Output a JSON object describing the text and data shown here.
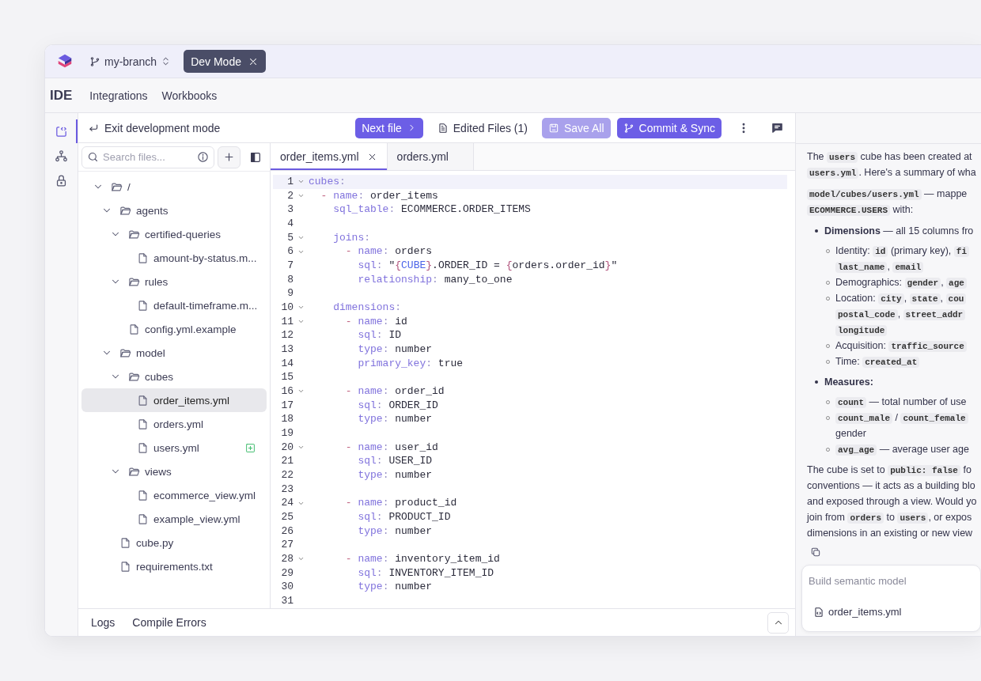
{
  "top_bar": {
    "branch": "my-branch",
    "mode_chip": "Dev Mode"
  },
  "nav": {
    "title": "IDE",
    "items": [
      {
        "label": "Integrations"
      },
      {
        "label": "Workbooks"
      }
    ]
  },
  "rail": [
    {
      "kind": "code",
      "selected": true
    },
    {
      "kind": "hierarchy",
      "selected": false
    },
    {
      "kind": "lock",
      "selected": false
    }
  ],
  "toolbar": {
    "exit": "Exit development mode",
    "buttons": [
      {
        "kind": "next",
        "label": "Next file",
        "disabled": false
      },
      {
        "kind": "edited",
        "label": "Edited Files (1)",
        "disabled": false
      },
      {
        "kind": "save",
        "label": "Save All",
        "disabled": true
      },
      {
        "kind": "commit",
        "label": "Commit & Sync",
        "disabled": false
      }
    ]
  },
  "file_sidebar": {
    "search": {
      "placeholder": "Search files..."
    },
    "tree": [
      {
        "kind": "folder",
        "name": "/",
        "expanded": true,
        "selected": false,
        "children": [
          {
            "kind": "folder",
            "name": "agents",
            "expanded": true,
            "selected": false,
            "children": [
              {
                "kind": "folder",
                "name": "certified-queries",
                "expanded": true,
                "selected": false,
                "children": [
                  {
                    "kind": "file",
                    "name": "amount-by-status.m...",
                    "selected": false,
                    "added": false
                  }
                ]
              },
              {
                "kind": "folder",
                "name": "rules",
                "expanded": true,
                "selected": false,
                "children": [
                  {
                    "kind": "file",
                    "name": "default-timeframe.m...",
                    "selected": false,
                    "added": false
                  }
                ]
              },
              {
                "kind": "file",
                "name": "config.yml.example",
                "selected": false,
                "added": false
              }
            ]
          },
          {
            "kind": "folder",
            "name": "model",
            "expanded": true,
            "selected": false,
            "children": [
              {
                "kind": "folder",
                "name": "cubes",
                "expanded": true,
                "selected": false,
                "children": [
                  {
                    "kind": "file",
                    "name": "order_items.yml",
                    "selected": true,
                    "added": false
                  },
                  {
                    "kind": "file",
                    "name": "orders.yml",
                    "selected": false,
                    "added": false
                  },
                  {
                    "kind": "file",
                    "name": "users.yml",
                    "selected": false,
                    "added": true
                  }
                ]
              },
              {
                "kind": "folder",
                "name": "views",
                "expanded": true,
                "selected": false,
                "children": [
                  {
                    "kind": "file",
                    "name": "ecommerce_view.yml",
                    "selected": false,
                    "added": false
                  },
                  {
                    "kind": "file",
                    "name": "example_view.yml",
                    "selected": false,
                    "added": false
                  }
                ]
              }
            ]
          },
          {
            "kind": "file",
            "name": "cube.py",
            "selected": false,
            "added": false
          },
          {
            "kind": "file",
            "name": "requirements.txt",
            "selected": false,
            "added": false
          }
        ]
      }
    ]
  },
  "editor": {
    "tabs": [
      {
        "label": "order_items.yml",
        "selected": true,
        "closable": true
      },
      {
        "label": "orders.yml",
        "selected": false,
        "closable": false
      }
    ],
    "lines": [
      {
        "number": "1",
        "foldable": true,
        "current": true,
        "tokens": [
          {
            "kind": "key",
            "text": "cubes"
          },
          {
            "kind": "punct",
            "text": ":"
          }
        ]
      },
      {
        "number": "2",
        "foldable": true,
        "current": false,
        "tokens": [
          {
            "kind": "dash",
            "text": "  - "
          },
          {
            "kind": "key",
            "text": "name"
          },
          {
            "kind": "punct",
            "text": ": "
          },
          {
            "kind": "value",
            "text": "order_items"
          }
        ]
      },
      {
        "number": "3",
        "foldable": false,
        "current": false,
        "tokens": [
          {
            "kind": "key",
            "text": "    sql_table"
          },
          {
            "kind": "punct",
            "text": ": "
          },
          {
            "kind": "value",
            "text": "ECOMMERCE.ORDER_ITEMS"
          }
        ]
      },
      {
        "number": "4",
        "foldable": false,
        "current": false
      },
      {
        "number": "5",
        "foldable": true,
        "current": false,
        "tokens": [
          {
            "kind": "key",
            "text": "    joins"
          },
          {
            "kind": "punct",
            "text": ":"
          }
        ]
      },
      {
        "number": "6",
        "foldable": true,
        "current": false,
        "tokens": [
          {
            "kind": "dash",
            "text": "      - "
          },
          {
            "kind": "key",
            "text": "name"
          },
          {
            "kind": "punct",
            "text": ": "
          },
          {
            "kind": "value",
            "text": "orders"
          }
        ]
      },
      {
        "number": "7",
        "foldable": false,
        "current": false,
        "tokens": [
          {
            "kind": "key",
            "text": "        sql"
          },
          {
            "kind": "punct",
            "text": ": "
          },
          {
            "kind": "value",
            "text": "\""
          },
          {
            "kind": "brace",
            "text": "{"
          },
          {
            "kind": "var",
            "text": "CUBE"
          },
          {
            "kind": "brace",
            "text": "}"
          },
          {
            "kind": "value",
            "text": ".ORDER_ID = "
          },
          {
            "kind": "brace",
            "text": "{"
          },
          {
            "kind": "value",
            "text": "orders.order_id"
          },
          {
            "kind": "brace",
            "text": "}"
          },
          {
            "kind": "value",
            "text": "\""
          }
        ]
      },
      {
        "number": "8",
        "foldable": false,
        "current": false,
        "tokens": [
          {
            "kind": "key",
            "text": "        relationship"
          },
          {
            "kind": "punct",
            "text": ": "
          },
          {
            "kind": "value",
            "text": "many_to_one"
          }
        ]
      },
      {
        "number": "9",
        "foldable": false,
        "current": false
      },
      {
        "number": "10",
        "foldable": true,
        "current": false,
        "tokens": [
          {
            "kind": "key",
            "text": "    dimensions"
          },
          {
            "kind": "punct",
            "text": ":"
          }
        ]
      },
      {
        "number": "11",
        "foldable": true,
        "current": false,
        "tokens": [
          {
            "kind": "dash",
            "text": "      - "
          },
          {
            "kind": "key",
            "text": "name"
          },
          {
            "kind": "punct",
            "text": ": "
          },
          {
            "kind": "value",
            "text": "id"
          }
        ]
      },
      {
        "number": "12",
        "foldable": false,
        "current": false,
        "tokens": [
          {
            "kind": "key",
            "text": "        sql"
          },
          {
            "kind": "punct",
            "text": ": "
          },
          {
            "kind": "value",
            "text": "ID"
          }
        ]
      },
      {
        "number": "13",
        "foldable": false,
        "current": false,
        "tokens": [
          {
            "kind": "key",
            "text": "        type"
          },
          {
            "kind": "punct",
            "text": ": "
          },
          {
            "kind": "value",
            "text": "number"
          }
        ]
      },
      {
        "number": "14",
        "foldable": false,
        "current": false,
        "tokens": [
          {
            "kind": "key",
            "text": "        primary_key"
          },
          {
            "kind": "punct",
            "text": ": "
          },
          {
            "kind": "value",
            "text": "true"
          }
        ]
      },
      {
        "number": "15",
        "foldable": false,
        "current": false
      },
      {
        "number": "16",
        "foldable": true,
        "current": false,
        "tokens": [
          {
            "kind": "dash",
            "text": "      - "
          },
          {
            "kind": "key",
            "text": "name"
          },
          {
            "kind": "punct",
            "text": ": "
          },
          {
            "kind": "value",
            "text": "order_id"
          }
        ]
      },
      {
        "number": "17",
        "foldable": false,
        "current": false,
        "tokens": [
          {
            "kind": "key",
            "text": "        sql"
          },
          {
            "kind": "punct",
            "text": ": "
          },
          {
            "kind": "value",
            "text": "ORDER_ID"
          }
        ]
      },
      {
        "number": "18",
        "foldable": false,
        "current": false,
        "tokens": [
          {
            "kind": "key",
            "text": "        type"
          },
          {
            "kind": "punct",
            "text": ": "
          },
          {
            "kind": "value",
            "text": "number"
          }
        ]
      },
      {
        "number": "19",
        "foldable": false,
        "current": false
      },
      {
        "number": "20",
        "foldable": true,
        "current": false,
        "tokens": [
          {
            "kind": "dash",
            "text": "      - "
          },
          {
            "kind": "key",
            "text": "name"
          },
          {
            "kind": "punct",
            "text": ": "
          },
          {
            "kind": "value",
            "text": "user_id"
          }
        ]
      },
      {
        "number": "21",
        "foldable": false,
        "current": false,
        "tokens": [
          {
            "kind": "key",
            "text": "        sql"
          },
          {
            "kind": "punct",
            "text": ": "
          },
          {
            "kind": "value",
            "text": "USER_ID"
          }
        ]
      },
      {
        "number": "22",
        "foldable": false,
        "current": false,
        "tokens": [
          {
            "kind": "key",
            "text": "        type"
          },
          {
            "kind": "punct",
            "text": ": "
          },
          {
            "kind": "value",
            "text": "number"
          }
        ]
      },
      {
        "number": "23",
        "foldable": false,
        "current": false
      },
      {
        "number": "24",
        "foldable": true,
        "current": false,
        "tokens": [
          {
            "kind": "dash",
            "text": "      - "
          },
          {
            "kind": "key",
            "text": "name"
          },
          {
            "kind": "punct",
            "text": ": "
          },
          {
            "kind": "value",
            "text": "product_id"
          }
        ]
      },
      {
        "number": "25",
        "foldable": false,
        "current": false,
        "tokens": [
          {
            "kind": "key",
            "text": "        sql"
          },
          {
            "kind": "punct",
            "text": ": "
          },
          {
            "kind": "value",
            "text": "PRODUCT_ID"
          }
        ]
      },
      {
        "number": "26",
        "foldable": false,
        "current": false,
        "tokens": [
          {
            "kind": "key",
            "text": "        type"
          },
          {
            "kind": "punct",
            "text": ": "
          },
          {
            "kind": "value",
            "text": "number"
          }
        ]
      },
      {
        "number": "27",
        "foldable": false,
        "current": false
      },
      {
        "number": "28",
        "foldable": true,
        "current": false,
        "tokens": [
          {
            "kind": "dash",
            "text": "      - "
          },
          {
            "kind": "key",
            "text": "name"
          },
          {
            "kind": "punct",
            "text": ": "
          },
          {
            "kind": "value",
            "text": "inventory_item_id"
          }
        ]
      },
      {
        "number": "29",
        "foldable": false,
        "current": false,
        "tokens": [
          {
            "kind": "key",
            "text": "        sql"
          },
          {
            "kind": "punct",
            "text": ": "
          },
          {
            "kind": "value",
            "text": "INVENTORY_ITEM_ID"
          }
        ]
      },
      {
        "number": "30",
        "foldable": false,
        "current": false,
        "tokens": [
          {
            "kind": "key",
            "text": "        type"
          },
          {
            "kind": "punct",
            "text": ": "
          },
          {
            "kind": "value",
            "text": "number"
          }
        ]
      },
      {
        "number": "31",
        "foldable": false,
        "current": false
      }
    ]
  },
  "bottom_bar": {
    "tabs": [
      {
        "label": "Logs"
      },
      {
        "label": "Compile Errors"
      }
    ]
  },
  "chat": {
    "blocks": [
      {
        "kind": "paragraph",
        "lines": [
          [
            {
              "kind": "text",
              "text": "The "
            },
            {
              "kind": "code",
              "text": "users"
            },
            {
              "kind": "text",
              "text": " cube has been created at"
            }
          ],
          [
            {
              "kind": "code",
              "text": "users.yml"
            },
            {
              "kind": "text",
              "text": ". Here's a summary of wha"
            }
          ]
        ]
      },
      {
        "kind": "paragraph",
        "lines": [
          [
            {
              "kind": "code",
              "text": "model/cubes/users.yml"
            },
            {
              "kind": "text",
              "text": " — mappe"
            }
          ],
          [
            {
              "kind": "code",
              "text": "ECOMMERCE.USERS"
            },
            {
              "kind": "text",
              "text": " with:"
            }
          ]
        ]
      },
      {
        "kind": "bullet",
        "lines": [
          [
            {
              "kind": "bold",
              "text": "Dimensions"
            },
            {
              "kind": "text",
              "text": " — all 15 columns fro"
            }
          ]
        ],
        "children": [
          {
            "lines": [
              [
                {
                  "kind": "text",
                  "text": "Identity: "
                },
                {
                  "kind": "code",
                  "text": "id"
                },
                {
                  "kind": "text",
                  "text": " (primary key), "
                },
                {
                  "kind": "code",
                  "text": "fi"
                }
              ],
              [
                {
                  "kind": "code",
                  "text": "last_name"
                },
                {
                  "kind": "text",
                  "text": ", "
                },
                {
                  "kind": "code",
                  "text": "email"
                }
              ]
            ]
          },
          {
            "lines": [
              [
                {
                  "kind": "text",
                  "text": "Demographics: "
                },
                {
                  "kind": "code",
                  "text": "gender"
                },
                {
                  "kind": "text",
                  "text": ", "
                },
                {
                  "kind": "code",
                  "text": "age"
                }
              ]
            ]
          },
          {
            "lines": [
              [
                {
                  "kind": "text",
                  "text": "Location: "
                },
                {
                  "kind": "code",
                  "text": "city"
                },
                {
                  "kind": "text",
                  "text": ", "
                },
                {
                  "kind": "code",
                  "text": "state"
                },
                {
                  "kind": "text",
                  "text": ", "
                },
                {
                  "kind": "code",
                  "text": "cou"
                }
              ],
              [
                {
                  "kind": "code",
                  "text": "postal_code"
                },
                {
                  "kind": "text",
                  "text": ", "
                },
                {
                  "kind": "code",
                  "text": "street_addr"
                }
              ],
              [
                {
                  "kind": "code",
                  "text": "longitude"
                }
              ]
            ]
          },
          {
            "lines": [
              [
                {
                  "kind": "text",
                  "text": "Acquisition: "
                },
                {
                  "kind": "code",
                  "text": "traffic_source"
                }
              ]
            ]
          },
          {
            "lines": [
              [
                {
                  "kind": "text",
                  "text": "Time: "
                },
                {
                  "kind": "code",
                  "text": "created_at"
                }
              ]
            ]
          }
        ]
      },
      {
        "kind": "bullet",
        "lines": [
          [
            {
              "kind": "bold",
              "text": "Measures:"
            }
          ]
        ],
        "children": [
          {
            "lines": [
              [
                {
                  "kind": "code",
                  "text": "count"
                },
                {
                  "kind": "text",
                  "text": " — total number of use"
                }
              ]
            ]
          },
          {
            "lines": [
              [
                {
                  "kind": "code",
                  "text": "count_male"
                },
                {
                  "kind": "text",
                  "text": " / "
                },
                {
                  "kind": "code",
                  "text": "count_female"
                }
              ],
              [
                {
                  "kind": "text",
                  "text": "gender"
                }
              ]
            ]
          },
          {
            "lines": [
              [
                {
                  "kind": "code",
                  "text": "avg_age"
                },
                {
                  "kind": "text",
                  "text": " — average user age"
                }
              ]
            ]
          }
        ]
      },
      {
        "kind": "paragraph",
        "lines": [
          [
            {
              "kind": "text",
              "text": "The cube is set to "
            },
            {
              "kind": "code",
              "text": "public: false"
            },
            {
              "kind": "text",
              "text": " fo"
            }
          ],
          [
            {
              "kind": "text",
              "text": "conventions — it acts as a building blo"
            }
          ],
          [
            {
              "kind": "text",
              "text": "and exposed through a view. Would yo"
            }
          ],
          [
            {
              "kind": "text",
              "text": "join from "
            },
            {
              "kind": "code",
              "text": "orders"
            },
            {
              "kind": "text",
              "text": " to "
            },
            {
              "kind": "code",
              "text": "users"
            },
            {
              "kind": "text",
              "text": ", or expos"
            }
          ],
          [
            {
              "kind": "text",
              "text": "dimensions in an existing or new view"
            }
          ]
        ]
      }
    ],
    "composer": {
      "placeholder": "Build semantic model",
      "attachment": "order_items.yml"
    }
  }
}
